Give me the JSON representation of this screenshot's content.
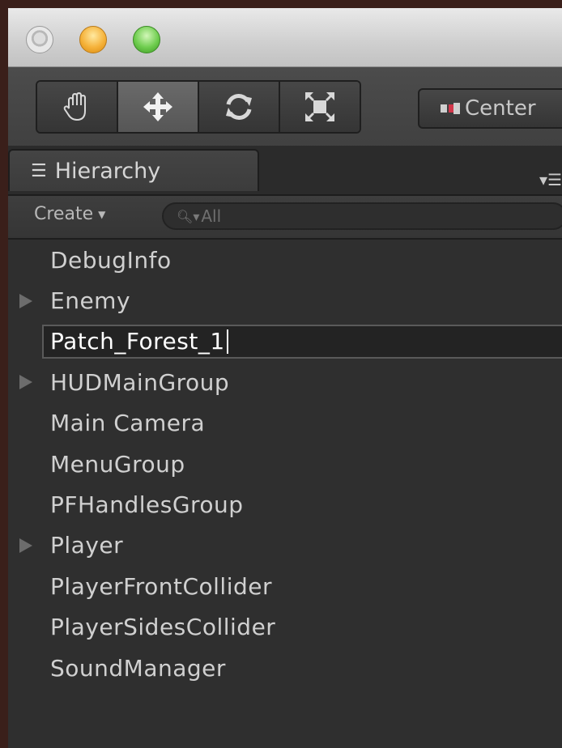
{
  "toolbar": {
    "tools": [
      "hand-icon",
      "move-icon",
      "rotate-icon",
      "scale-icon"
    ],
    "active_tool": "move-icon",
    "pivot_label": "Center"
  },
  "hierarchy": {
    "tab_label": "Hierarchy",
    "create_label": "Create",
    "search_placeholder": "All",
    "items": [
      {
        "label": "DebugInfo",
        "expandable": false
      },
      {
        "label": "Enemy",
        "expandable": true
      },
      {
        "label": "Patch_Forest_1",
        "expandable": false,
        "editing": true
      },
      {
        "label": "HUDMainGroup",
        "expandable": true
      },
      {
        "label": "Main Camera",
        "expandable": false
      },
      {
        "label": "MenuGroup",
        "expandable": false
      },
      {
        "label": "PFHandlesGroup",
        "expandable": false
      },
      {
        "label": "Player",
        "expandable": true
      },
      {
        "label": "PlayerFrontCollider",
        "expandable": false
      },
      {
        "label": "PlayerSidesCollider",
        "expandable": false
      },
      {
        "label": "SoundManager",
        "expandable": false
      }
    ]
  }
}
